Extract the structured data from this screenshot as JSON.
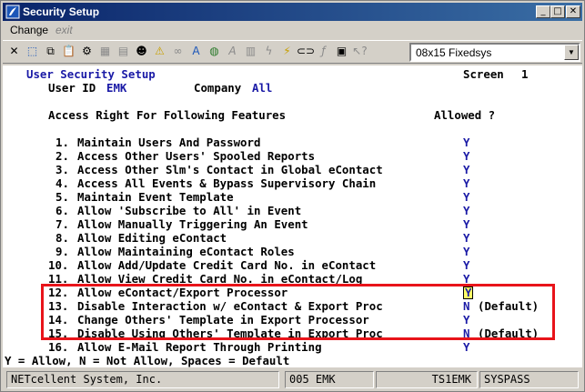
{
  "window": {
    "title": "Security Setup"
  },
  "title_buttons": {
    "minimize": "_",
    "maximize": "□",
    "close": "✕"
  },
  "menu": {
    "items": [
      {
        "label": "Change"
      },
      {
        "label": "exit"
      }
    ]
  },
  "toolbar": {
    "buttons": [
      "close-x",
      "select",
      "copy",
      "paste",
      "settings",
      "calculator",
      "notes",
      "person",
      "warning",
      "binoculars",
      "font-a",
      "globe",
      "italic-a",
      "trash",
      "lightning",
      "script",
      "link",
      "formula",
      "notebook",
      "help-arrow"
    ],
    "font_select": {
      "value": "08x15 Fixedsys"
    }
  },
  "screen": {
    "heading": "User Security Setup",
    "screen_label": "Screen",
    "screen_number": "1",
    "user_id_label": "User ID",
    "user_id_value": "EMK",
    "company_label": "Company",
    "company_value": "All",
    "section_title": "Access Right For Following Features",
    "allowed_header": "Allowed ?",
    "rows": [
      {
        "num": "1.",
        "label": "Maintain Users And Password",
        "value": "Y",
        "default": ""
      },
      {
        "num": "2.",
        "label": "Access Other Users' Spooled Reports",
        "value": "Y",
        "default": ""
      },
      {
        "num": "3.",
        "label": "Access Other Slm's Contact in Global eContact",
        "value": "Y",
        "default": ""
      },
      {
        "num": "4.",
        "label": "Access All Events & Bypass Supervisory Chain",
        "value": "Y",
        "default": ""
      },
      {
        "num": "5.",
        "label": "Maintain Event Template",
        "value": "Y",
        "default": ""
      },
      {
        "num": "6.",
        "label": "Allow 'Subscribe to All' in Event",
        "value": "Y",
        "default": ""
      },
      {
        "num": "7.",
        "label": "Allow Manually Triggering An Event",
        "value": "Y",
        "default": ""
      },
      {
        "num": "8.",
        "label": "Allow Editing eContact",
        "value": "Y",
        "default": ""
      },
      {
        "num": "9.",
        "label": "Allow Maintaining eContact Roles",
        "value": "Y",
        "default": ""
      },
      {
        "num": "10.",
        "label": "Allow Add/Update Credit Card No. in eContact",
        "value": "Y",
        "default": ""
      },
      {
        "num": "11.",
        "label": "Allow View Credit Card No. in eContact/Log",
        "value": "Y",
        "default": ""
      },
      {
        "num": "12.",
        "label": "Allow eContact/Export Processor",
        "value": "Y",
        "default": ""
      },
      {
        "num": "13.",
        "label": "Disable Interaction w/ eContact & Export Proc",
        "value": "N",
        "default": "(Default)"
      },
      {
        "num": "14.",
        "label": "Change Others' Template in Export Processor",
        "value": "Y",
        "default": ""
      },
      {
        "num": "15.",
        "label": "Disable Using Others' Template in Export Proc",
        "value": "N",
        "default": "(Default)"
      },
      {
        "num": "16.",
        "label": "Allow E-Mail Report Through Printing",
        "value": "Y",
        "default": ""
      }
    ]
  },
  "legend": "Y = Allow, N = Not Allow, Spaces = Default",
  "status": {
    "company": "NETcellent System, Inc.",
    "session": "005 EMK",
    "terminal": "TS1EMK",
    "mode": "SYSPASS"
  },
  "colors": {
    "highlight": "#e8141a",
    "value_text": "#1a1aa6",
    "title_bar": "#0a246a"
  }
}
